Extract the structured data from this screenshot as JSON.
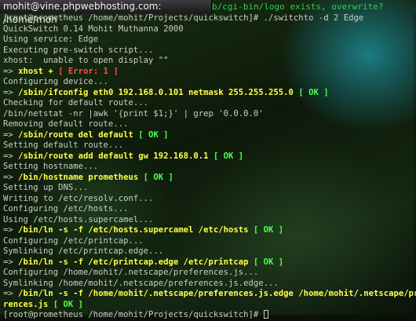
{
  "window": {
    "title": "mohit@vine.phpwebhosting.com: /home/moh",
    "behind_text": "b/cgi-bin/logo exists, overwrite? "
  },
  "terminal": {
    "lines": [
      {
        "pre": "[root@prometheus /home/mohit/Projects/quickswitch]# ./switchto -d 2 Edge",
        "cmd": "",
        "tag": "",
        "kind": ""
      },
      {
        "pre": "QuickSwitch 0.14 Mohit Muthanna 2000",
        "cmd": "",
        "tag": "",
        "kind": ""
      },
      {
        "pre": "Using service: Edge",
        "cmd": "",
        "tag": "",
        "kind": ""
      },
      {
        "pre": "Executing pre-switch script...",
        "cmd": "",
        "tag": "",
        "kind": ""
      },
      {
        "pre": "xhost:  unable to open display \"\"",
        "cmd": "",
        "tag": "",
        "kind": ""
      },
      {
        "pre": "=> ",
        "cmd": "xhost +",
        "tag": " [ Error: 1 ]",
        "kind": "err"
      },
      {
        "pre": "Configuring device...",
        "cmd": "",
        "tag": "",
        "kind": ""
      },
      {
        "pre": "=> ",
        "cmd": "/sbin/ifconfig eth0 192.168.0.101 netmask 255.255.255.0",
        "tag": " [ OK ]",
        "kind": "ok"
      },
      {
        "pre": "Checking for default route...",
        "cmd": "",
        "tag": "",
        "kind": ""
      },
      {
        "pre": "/bin/netstat -nr |awk '{print $1;}' | grep '0.0.0.0'",
        "cmd": "",
        "tag": "",
        "kind": ""
      },
      {
        "pre": "Removing default route...",
        "cmd": "",
        "tag": "",
        "kind": ""
      },
      {
        "pre": "=> ",
        "cmd": "/sbin/route del default",
        "tag": " [ OK ]",
        "kind": "ok"
      },
      {
        "pre": "Setting default route...",
        "cmd": "",
        "tag": "",
        "kind": ""
      },
      {
        "pre": "=> ",
        "cmd": "/sbin/route add default gw 192.168.0.1",
        "tag": " [ OK ]",
        "kind": "ok"
      },
      {
        "pre": "Setting hostname...",
        "cmd": "",
        "tag": "",
        "kind": ""
      },
      {
        "pre": "=> ",
        "cmd": "/bin/hostname prometheus",
        "tag": " [ OK ]",
        "kind": "ok"
      },
      {
        "pre": "Setting up DNS...",
        "cmd": "",
        "tag": "",
        "kind": ""
      },
      {
        "pre": "Writing to /etc/resolv.conf...",
        "cmd": "",
        "tag": "",
        "kind": ""
      },
      {
        "pre": "Configuring /etc/hosts...",
        "cmd": "",
        "tag": "",
        "kind": ""
      },
      {
        "pre": "Using /etc/hosts.supercamel...",
        "cmd": "",
        "tag": "",
        "kind": ""
      },
      {
        "pre": "=> ",
        "cmd": "/bin/ln -s -f /etc/hosts.supercamel /etc/hosts",
        "tag": " [ OK ]",
        "kind": "ok"
      },
      {
        "pre": "Configuring /etc/printcap...",
        "cmd": "",
        "tag": "",
        "kind": ""
      },
      {
        "pre": "Symlinking /etc/printcap.edge...",
        "cmd": "",
        "tag": "",
        "kind": ""
      },
      {
        "pre": "=> ",
        "cmd": "/bin/ln -s -f /etc/printcap.edge /etc/printcap",
        "tag": " [ OK ]",
        "kind": "ok"
      },
      {
        "pre": "Configuring /home/mohit/.netscape/preferences.js...",
        "cmd": "",
        "tag": "",
        "kind": ""
      },
      {
        "pre": "Symlinking /home/mohit/.netscape/preferences.js.edge...",
        "cmd": "",
        "tag": "",
        "kind": ""
      },
      {
        "pre": "=> ",
        "cmd": "/bin/ln -s -f /home/mohit/.netscape/preferences.js.edge /home/mohit/.netscape/prefe",
        "tag": "",
        "kind": ""
      },
      {
        "pre": "",
        "cmd": "rences.js",
        "tag": " [ OK ]",
        "kind": "ok"
      },
      {
        "pre": "[root@prometheus /home/mohit/Projects/quickswitch]# ",
        "cmd": "",
        "tag": "",
        "kind": "",
        "cursor": true
      }
    ]
  },
  "colors": {
    "command": "#ffff4a",
    "ok": "#4cff4c",
    "error": "#ff4a4a",
    "text": "#c9cfc6"
  }
}
